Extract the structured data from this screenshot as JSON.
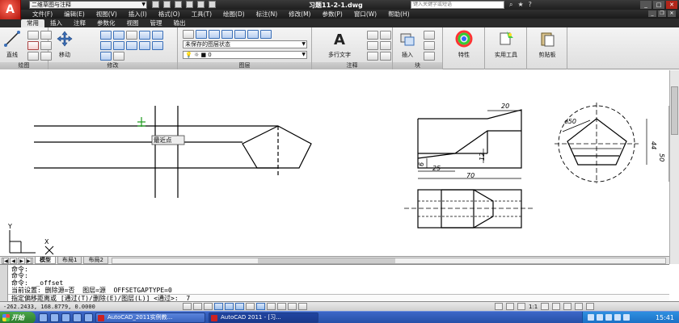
{
  "titlebar": {
    "app_letter": "A",
    "workspace": "二维草图与注释",
    "title": "习题11-2-1.dwg",
    "search_placeholder": "键入关键字或短语"
  },
  "menubar": {
    "items": [
      "文件(F)",
      "编辑(E)",
      "视图(V)",
      "插入(I)",
      "格式(O)",
      "工具(T)",
      "绘图(D)",
      "标注(N)",
      "修改(M)",
      "参数(P)",
      "窗口(W)",
      "帮助(H)"
    ]
  },
  "ribbon": {
    "tabs": [
      "常用",
      "插入",
      "注释",
      "参数化",
      "视图",
      "管理",
      "输出"
    ],
    "panels": {
      "draw": {
        "title": "绘图",
        "line": "直线"
      },
      "modify": {
        "title": "修改",
        "move": "移动"
      },
      "layers": {
        "title": "图层",
        "layer_state": "未保存的图层状态",
        "current_layer": "0"
      },
      "annotation": {
        "title": "注释",
        "mtext": "多行文字"
      },
      "block": {
        "title": "块",
        "insert": "插入"
      },
      "properties": {
        "label": "特性"
      },
      "utilities": {
        "label": "实用工具"
      },
      "clipboard": {
        "label": "剪贴板"
      }
    }
  },
  "drawing": {
    "osnap_tooltip": "最近点",
    "dims": {
      "d20": "20",
      "d6": "6",
      "d12": "12",
      "d25": "25",
      "d70": "70",
      "dia50": "⌀50",
      "d44": "44",
      "d50": "50"
    },
    "ucs": {
      "x": "X",
      "y": "Y"
    }
  },
  "layout_tabs": [
    "模型",
    "布局1",
    "布局2"
  ],
  "command": {
    "lines": [
      "命令:",
      "命令:",
      "命令:  _offset",
      "当前设置: 删除源=否  图层=源  OFFSETGAPTYPE=0",
      "指定偏移距离或 [通过(T)/删除(E)/图层(L)] <通过>:  7"
    ]
  },
  "status": {
    "coords": "-262.2433, 168.8779, 0.0000",
    "scale": "1:1"
  },
  "taskbar": {
    "start": "开始",
    "tasks": [
      "AutoCAD_2011实例教...",
      "AutoCAD 2011 - [习..."
    ],
    "clock": "15:41"
  }
}
